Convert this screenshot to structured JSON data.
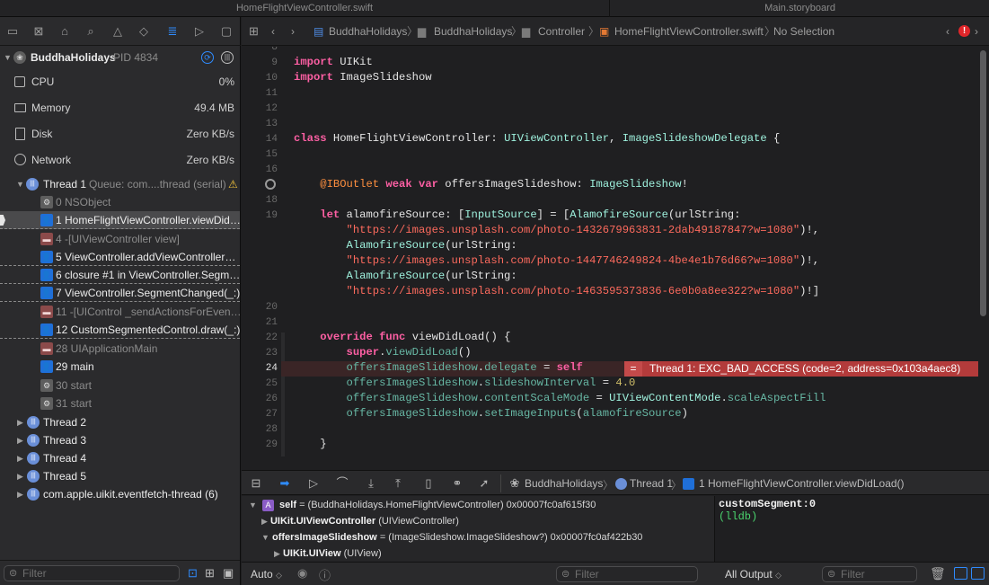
{
  "window_tabs": [
    "HomeFlightViewController.swift",
    "Main.storyboard"
  ],
  "navigator": {
    "process": {
      "name": "BuddhaHolidays",
      "pid": "PID 4834"
    },
    "gauges": [
      {
        "label": "CPU",
        "value": "0%",
        "icon": "cpu-icon"
      },
      {
        "label": "Memory",
        "value": "49.4 MB",
        "icon": "memory-icon"
      },
      {
        "label": "Disk",
        "value": "Zero KB/s",
        "icon": "disk-icon"
      },
      {
        "label": "Network",
        "value": "Zero KB/s",
        "icon": "network-icon"
      }
    ],
    "thread1": {
      "label": "Thread 1",
      "queue": "Queue: com....thread (serial)"
    },
    "frames": [
      {
        "text": "0 NSObject",
        "kind": "gray"
      },
      {
        "text": "1 HomeFlightViewController.viewDid…",
        "kind": "blue"
      },
      {
        "text": "4 -[UIViewController view]",
        "kind": "red"
      },
      {
        "text": "5 ViewController.addViewController…",
        "kind": "blue"
      },
      {
        "text": "6 closure #1 in ViewController.Segm…",
        "kind": "blue"
      },
      {
        "text": "7 ViewController.SegmentChanged(_:)",
        "kind": "blue"
      },
      {
        "text": "11 -[UIControl _sendActionsForEven…",
        "kind": "red"
      },
      {
        "text": "12 CustomSegmentedControl.draw(_:)",
        "kind": "blue"
      },
      {
        "text": "28 UIApplicationMain",
        "kind": "red"
      },
      {
        "text": "29 main",
        "kind": "blue"
      },
      {
        "text": "30 start",
        "kind": "gray"
      },
      {
        "text": "31 start",
        "kind": "gray"
      }
    ],
    "threads": [
      "Thread 2",
      "Thread 3",
      "Thread 4",
      "Thread 5",
      "com.apple.uikit.eventfetch-thread (6)"
    ],
    "filter_placeholder": "Filter"
  },
  "jumpbar": {
    "path": [
      "BuddhaHolidays",
      "BuddhaHolidays",
      "Controller",
      "HomeFlightViewController.swift",
      "No Selection"
    ]
  },
  "editor": {
    "line_numbers": [
      "8",
      "9",
      "10",
      "11",
      "12",
      "13",
      "14",
      "15",
      "16",
      "",
      "18",
      "19",
      "",
      "",
      "",
      "",
      "20",
      "21",
      "22",
      "23",
      "24",
      "25",
      "26",
      "27",
      "28",
      "29"
    ],
    "error": {
      "marker": "=",
      "message": "Thread 1: EXC_BAD_ACCESS (code=2, address=0x103a4aec8)"
    }
  },
  "debugbar": {
    "breadcrumb": [
      "BuddhaHolidays",
      "Thread 1",
      "1 HomeFlightViewController.viewDidLoad()"
    ]
  },
  "variables": [
    {
      "name": "self",
      "detail": "= (BuddhaHolidays.HomeFlightViewController) 0x00007fc0af615f30"
    },
    {
      "name": "UIKit.UIViewController",
      "detail": "(UIViewController)"
    },
    {
      "name": "offersImageSlideshow",
      "detail": "= (ImageSlideshow.ImageSlideshow?) 0x00007fc0af422b30"
    },
    {
      "name": "UIKit.UIView",
      "detail": "(UIView)"
    }
  ],
  "console": {
    "line1": "customSegment:0",
    "line2": "(lldb)"
  },
  "bottom": {
    "auto": "Auto",
    "all_output": "All Output",
    "filter": "Filter"
  }
}
